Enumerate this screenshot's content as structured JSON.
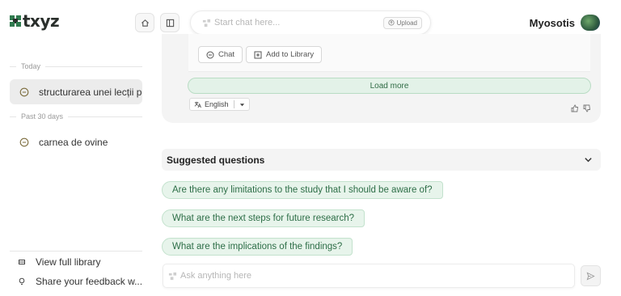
{
  "header": {
    "logo_text": "txyz",
    "search_placeholder": "Start chat here...",
    "upload_label": "Upload",
    "user_name": "Myosotis"
  },
  "sidebar": {
    "sections": [
      {
        "label": "Today",
        "items": [
          {
            "label": "structurarea unei lecții p",
            "active": true
          }
        ]
      },
      {
        "label": "Past 30 days",
        "items": [
          {
            "label": "carnea de ovine",
            "active": false
          }
        ]
      }
    ],
    "footer": {
      "library_label": "View full library",
      "feedback_label": "Share your feedback w..."
    }
  },
  "main": {
    "chat_button": "Chat",
    "add_library_button": "Add to Library",
    "load_more": "Load more",
    "language": "English",
    "suggested_title": "Suggested questions",
    "questions": [
      "Are there any limitations to the study that I should be aware of?",
      "What are the next steps for future research?",
      "What are the implications of the findings?"
    ],
    "ask_placeholder": "Ask anything here"
  },
  "colors": {
    "accent_green": "#2d6e47",
    "accent_green_bg": "#e7f4eb"
  }
}
